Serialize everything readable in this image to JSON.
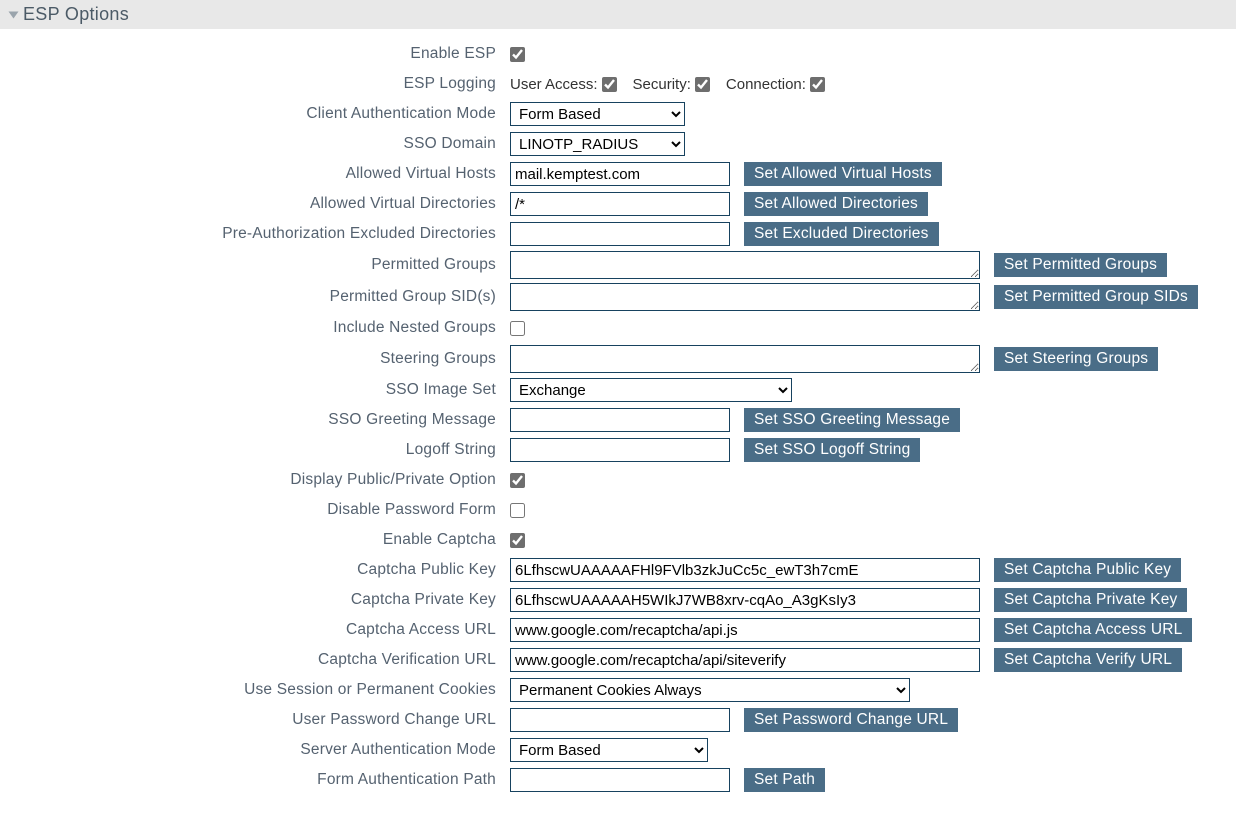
{
  "section": {
    "title": "ESP Options"
  },
  "labels": {
    "enable_esp": "Enable ESP",
    "esp_logging": "ESP Logging",
    "client_auth_mode": "Client Authentication Mode",
    "sso_domain": "SSO Domain",
    "allowed_virtual_hosts": "Allowed Virtual Hosts",
    "allowed_virtual_dirs": "Allowed Virtual Directories",
    "preauth_excluded_dirs": "Pre-Authorization Excluded Directories",
    "permitted_groups": "Permitted Groups",
    "permitted_group_sids": "Permitted Group SID(s)",
    "include_nested_groups": "Include Nested Groups",
    "steering_groups": "Steering Groups",
    "sso_image_set": "SSO Image Set",
    "sso_greeting": "SSO Greeting Message",
    "logoff_string": "Logoff String",
    "display_public_private": "Display Public/Private Option",
    "disable_password_form": "Disable Password Form",
    "enable_captcha": "Enable Captcha",
    "captcha_public_key": "Captcha Public Key",
    "captcha_private_key": "Captcha Private Key",
    "captcha_access_url": "Captcha Access URL",
    "captcha_verify_url": "Captcha Verification URL",
    "cookies_mode": "Use Session or Permanent Cookies",
    "user_pw_change_url": "User Password Change URL",
    "server_auth_mode": "Server Authentication Mode",
    "form_auth_path": "Form Authentication Path"
  },
  "logging": {
    "user_access_label": "User Access:",
    "security_label": "Security:",
    "connection_label": "Connection:"
  },
  "values": {
    "client_auth_mode": "Form Based",
    "sso_domain": "LINOTP_RADIUS",
    "allowed_virtual_hosts": "mail.kemptest.com",
    "allowed_virtual_dirs": "/*",
    "preauth_excluded_dirs": "",
    "permitted_groups": "",
    "permitted_group_sids": "",
    "steering_groups": "",
    "sso_image_set": "Exchange",
    "sso_greeting": "",
    "logoff_string": "",
    "captcha_public_key": "6LfhscwUAAAAAFHl9FVlb3zkJuCc5c_ewT3h7cmE",
    "captcha_private_key": "6LfhscwUAAAAAH5WIkJ7WB8xrv-cqAo_A3gKsIy3",
    "captcha_access_url": "www.google.com/recaptcha/api.js",
    "captcha_verify_url": "www.google.com/recaptcha/api/siteverify",
    "cookies_mode": "Permanent Cookies Always",
    "user_pw_change_url": "",
    "server_auth_mode": "Form Based",
    "form_auth_path": ""
  },
  "buttons": {
    "set_allowed_virtual_hosts": "Set Allowed Virtual Hosts",
    "set_allowed_directories": "Set Allowed Directories",
    "set_excluded_directories": "Set Excluded Directories",
    "set_permitted_groups": "Set Permitted Groups",
    "set_permitted_group_sids": "Set Permitted Group SIDs",
    "set_steering_groups": "Set Steering Groups",
    "set_sso_greeting": "Set SSO Greeting Message",
    "set_sso_logoff": "Set SSO Logoff String",
    "set_captcha_public_key": "Set Captcha Public Key",
    "set_captcha_private_key": "Set Captcha Private Key",
    "set_captcha_access_url": "Set Captcha Access URL",
    "set_captcha_verify_url": "Set Captcha Verify URL",
    "set_password_change_url": "Set Password Change URL",
    "set_path": "Set Path"
  }
}
